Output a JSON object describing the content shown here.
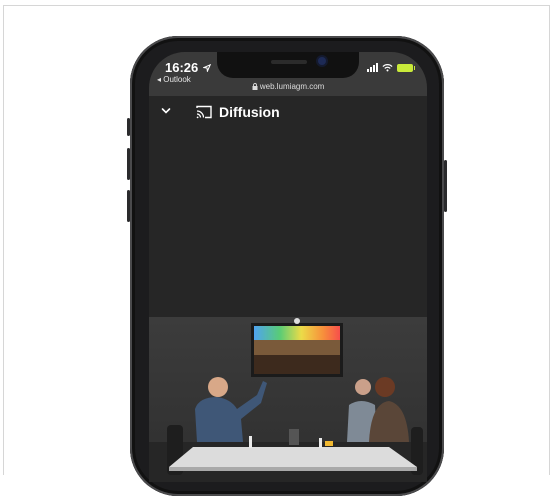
{
  "status_bar": {
    "time": "16:26",
    "back_app": "◂ Outlook",
    "url": "web.lumiagm.com"
  },
  "header": {
    "title": "Diffusion"
  },
  "icons": {
    "location": "location-arrow-icon",
    "lock": "lock-icon",
    "signal": "signal-icon",
    "wifi": "wifi-icon",
    "battery": "battery-icon",
    "back": "chevron-down-icon",
    "cast": "cast-icon"
  },
  "colors": {
    "battery": "#c9ea3a",
    "background": "#262626"
  }
}
